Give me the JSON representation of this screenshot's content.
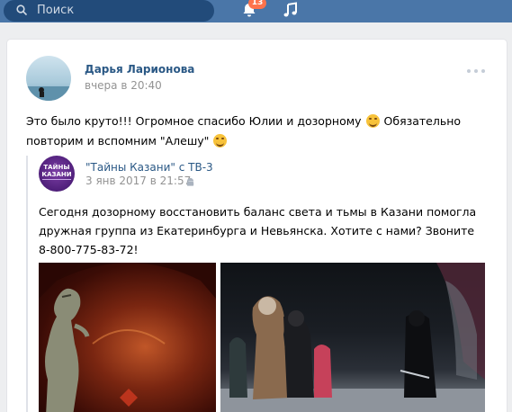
{
  "header": {
    "search_placeholder": "Поиск",
    "notifications_count": "13"
  },
  "post": {
    "author": "Дарья Ларионова",
    "time": "вчера в 20:40",
    "text_part1": "Это было круто!!! Огромное спасибо Юлии и дозорному",
    "text_part2": "Обязательно повторим и вспомним \"Алешу\""
  },
  "repost": {
    "avatar_text": "ТАЙНЫ КАЗАНИ",
    "title": "\"Тайны Казани\" с ТВ-3",
    "time": "3 янв 2017 в 21:57",
    "text": "Сегодня дозорному восстановить баланс света и тьмы в Казани помогла дружная группа из Екатеринбурга и Невьянска. Хотите с нами? Звоните 8-800-775-83-72!"
  },
  "colors": {
    "header_bg": "#4a76a8",
    "link": "#2a5885",
    "badge": "#ff734c"
  }
}
